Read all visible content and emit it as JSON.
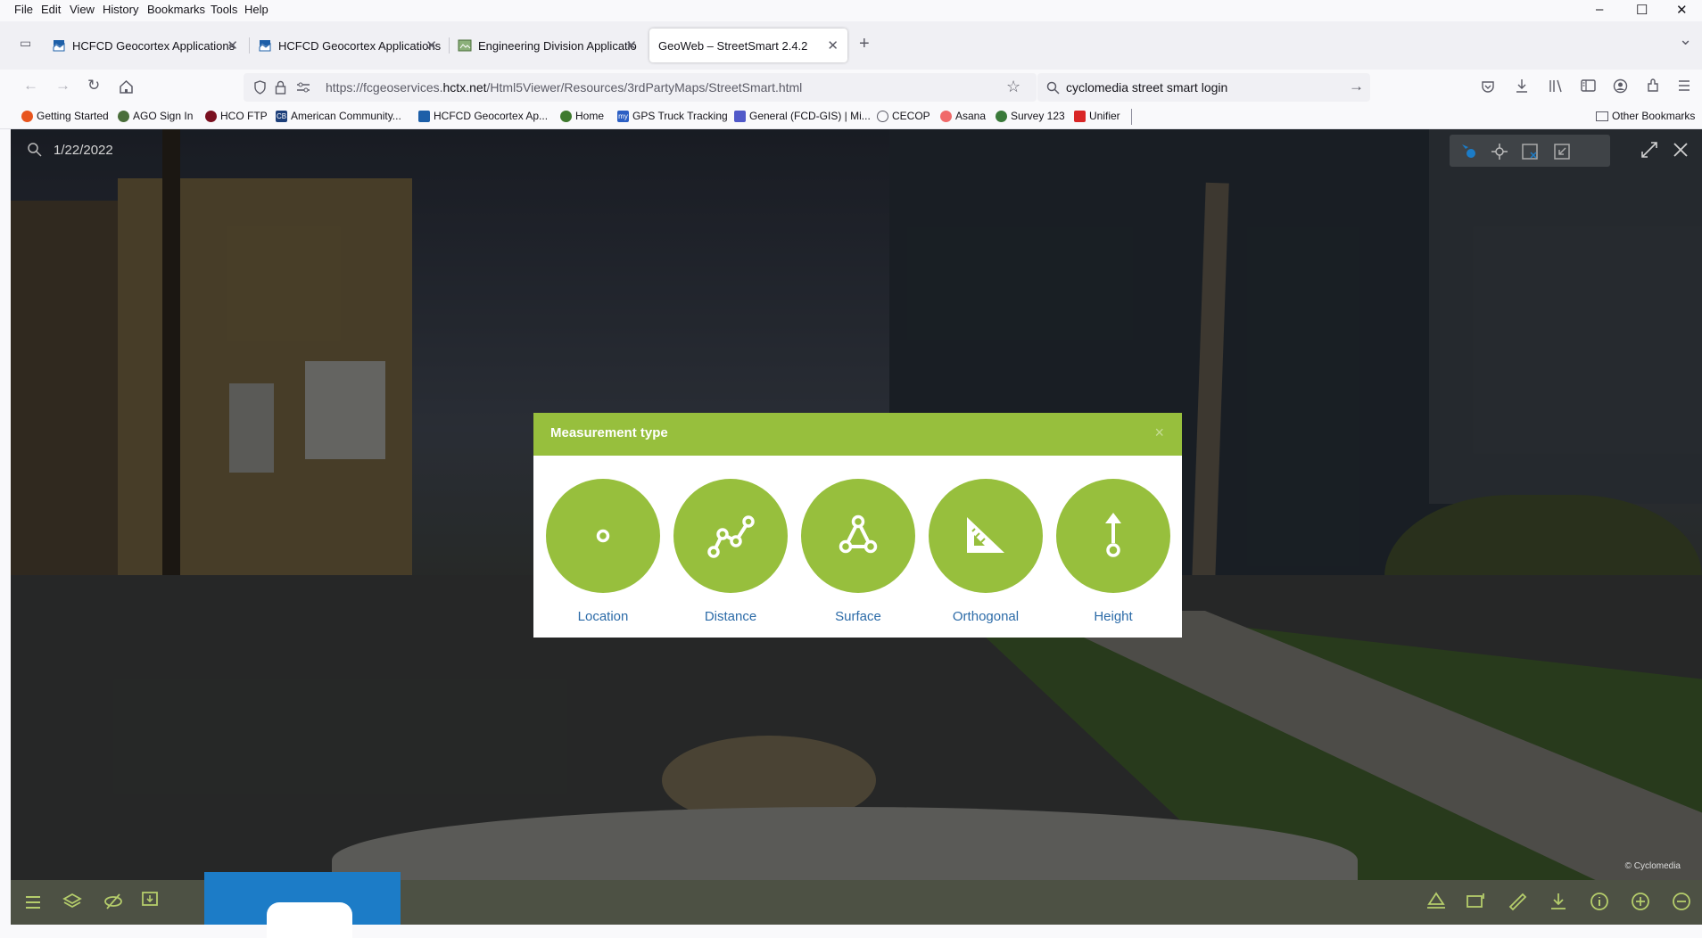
{
  "menubar": {
    "items": [
      "File",
      "Edit",
      "View",
      "History",
      "Bookmarks",
      "Tools",
      "Help"
    ]
  },
  "window_controls": {
    "minimize": "–",
    "maximize": "☐",
    "close": "✕"
  },
  "tabs": [
    {
      "label": "HCFCD Geocortex Applications",
      "active": false
    },
    {
      "label": "HCFCD Geocortex Applications",
      "active": false
    },
    {
      "label": "Engineering Division Applicatio",
      "active": false
    },
    {
      "label": "GeoWeb – StreetSmart 2.4.2",
      "active": true
    }
  ],
  "tab_close_glyph": "✕",
  "new_tab_glyph": "+",
  "tab_list_glyph": "⌄",
  "nav": {
    "url_prefix": "https://fcgeoservices.",
    "url_domain": "hctx.net",
    "url_path": "/Html5Viewer/Resources/3rdPartyMaps/StreetSmart.html",
    "search_query": "cyclomedia street smart login"
  },
  "bookmarks": [
    {
      "label": "Getting Started",
      "color": "#e8551e"
    },
    {
      "label": "AGO Sign In",
      "color": "#4a6e3a"
    },
    {
      "label": "HCO FTP",
      "color": "#7a1020"
    },
    {
      "label": "American Community...",
      "color": "#1d3f7a",
      "badge": "CB"
    },
    {
      "label": "HCFCD Geocortex Ap...",
      "color": "#1d5fa8"
    },
    {
      "label": "Home",
      "color": "#3f7a2e"
    },
    {
      "label": "GPS Truck Tracking",
      "color": "#2c5fc4",
      "badge": "my"
    },
    {
      "label": "General (FCD-GIS) | Mi...",
      "color": "#5059c9"
    },
    {
      "label": "CECOP",
      "color": "#5b5b66"
    },
    {
      "label": "Asana",
      "color": "#f06a6a"
    },
    {
      "label": "Survey 123",
      "color": "#3a7a3a"
    },
    {
      "label": "Unifier",
      "color": "#d92626"
    }
  ],
  "other_bookmarks": "Other Bookmarks",
  "viewer": {
    "date": "1/22/2022",
    "copyright": "© Cyclomedia"
  },
  "modal": {
    "title": "Measurement type",
    "close_glyph": "×",
    "options": [
      {
        "label": "Location",
        "icon": "location-point-icon"
      },
      {
        "label": "Distance",
        "icon": "distance-line-icon"
      },
      {
        "label": "Surface",
        "icon": "surface-polygon-icon"
      },
      {
        "label": "Orthogonal",
        "icon": "orthogonal-set-square-icon"
      },
      {
        "label": "Height",
        "icon": "height-arrow-icon"
      }
    ]
  },
  "colors": {
    "accent_green": "#97bf3d",
    "link_blue": "#2c6ba8",
    "footer_bg": "#4d5144",
    "panel_blue": "#1c7cc7"
  }
}
